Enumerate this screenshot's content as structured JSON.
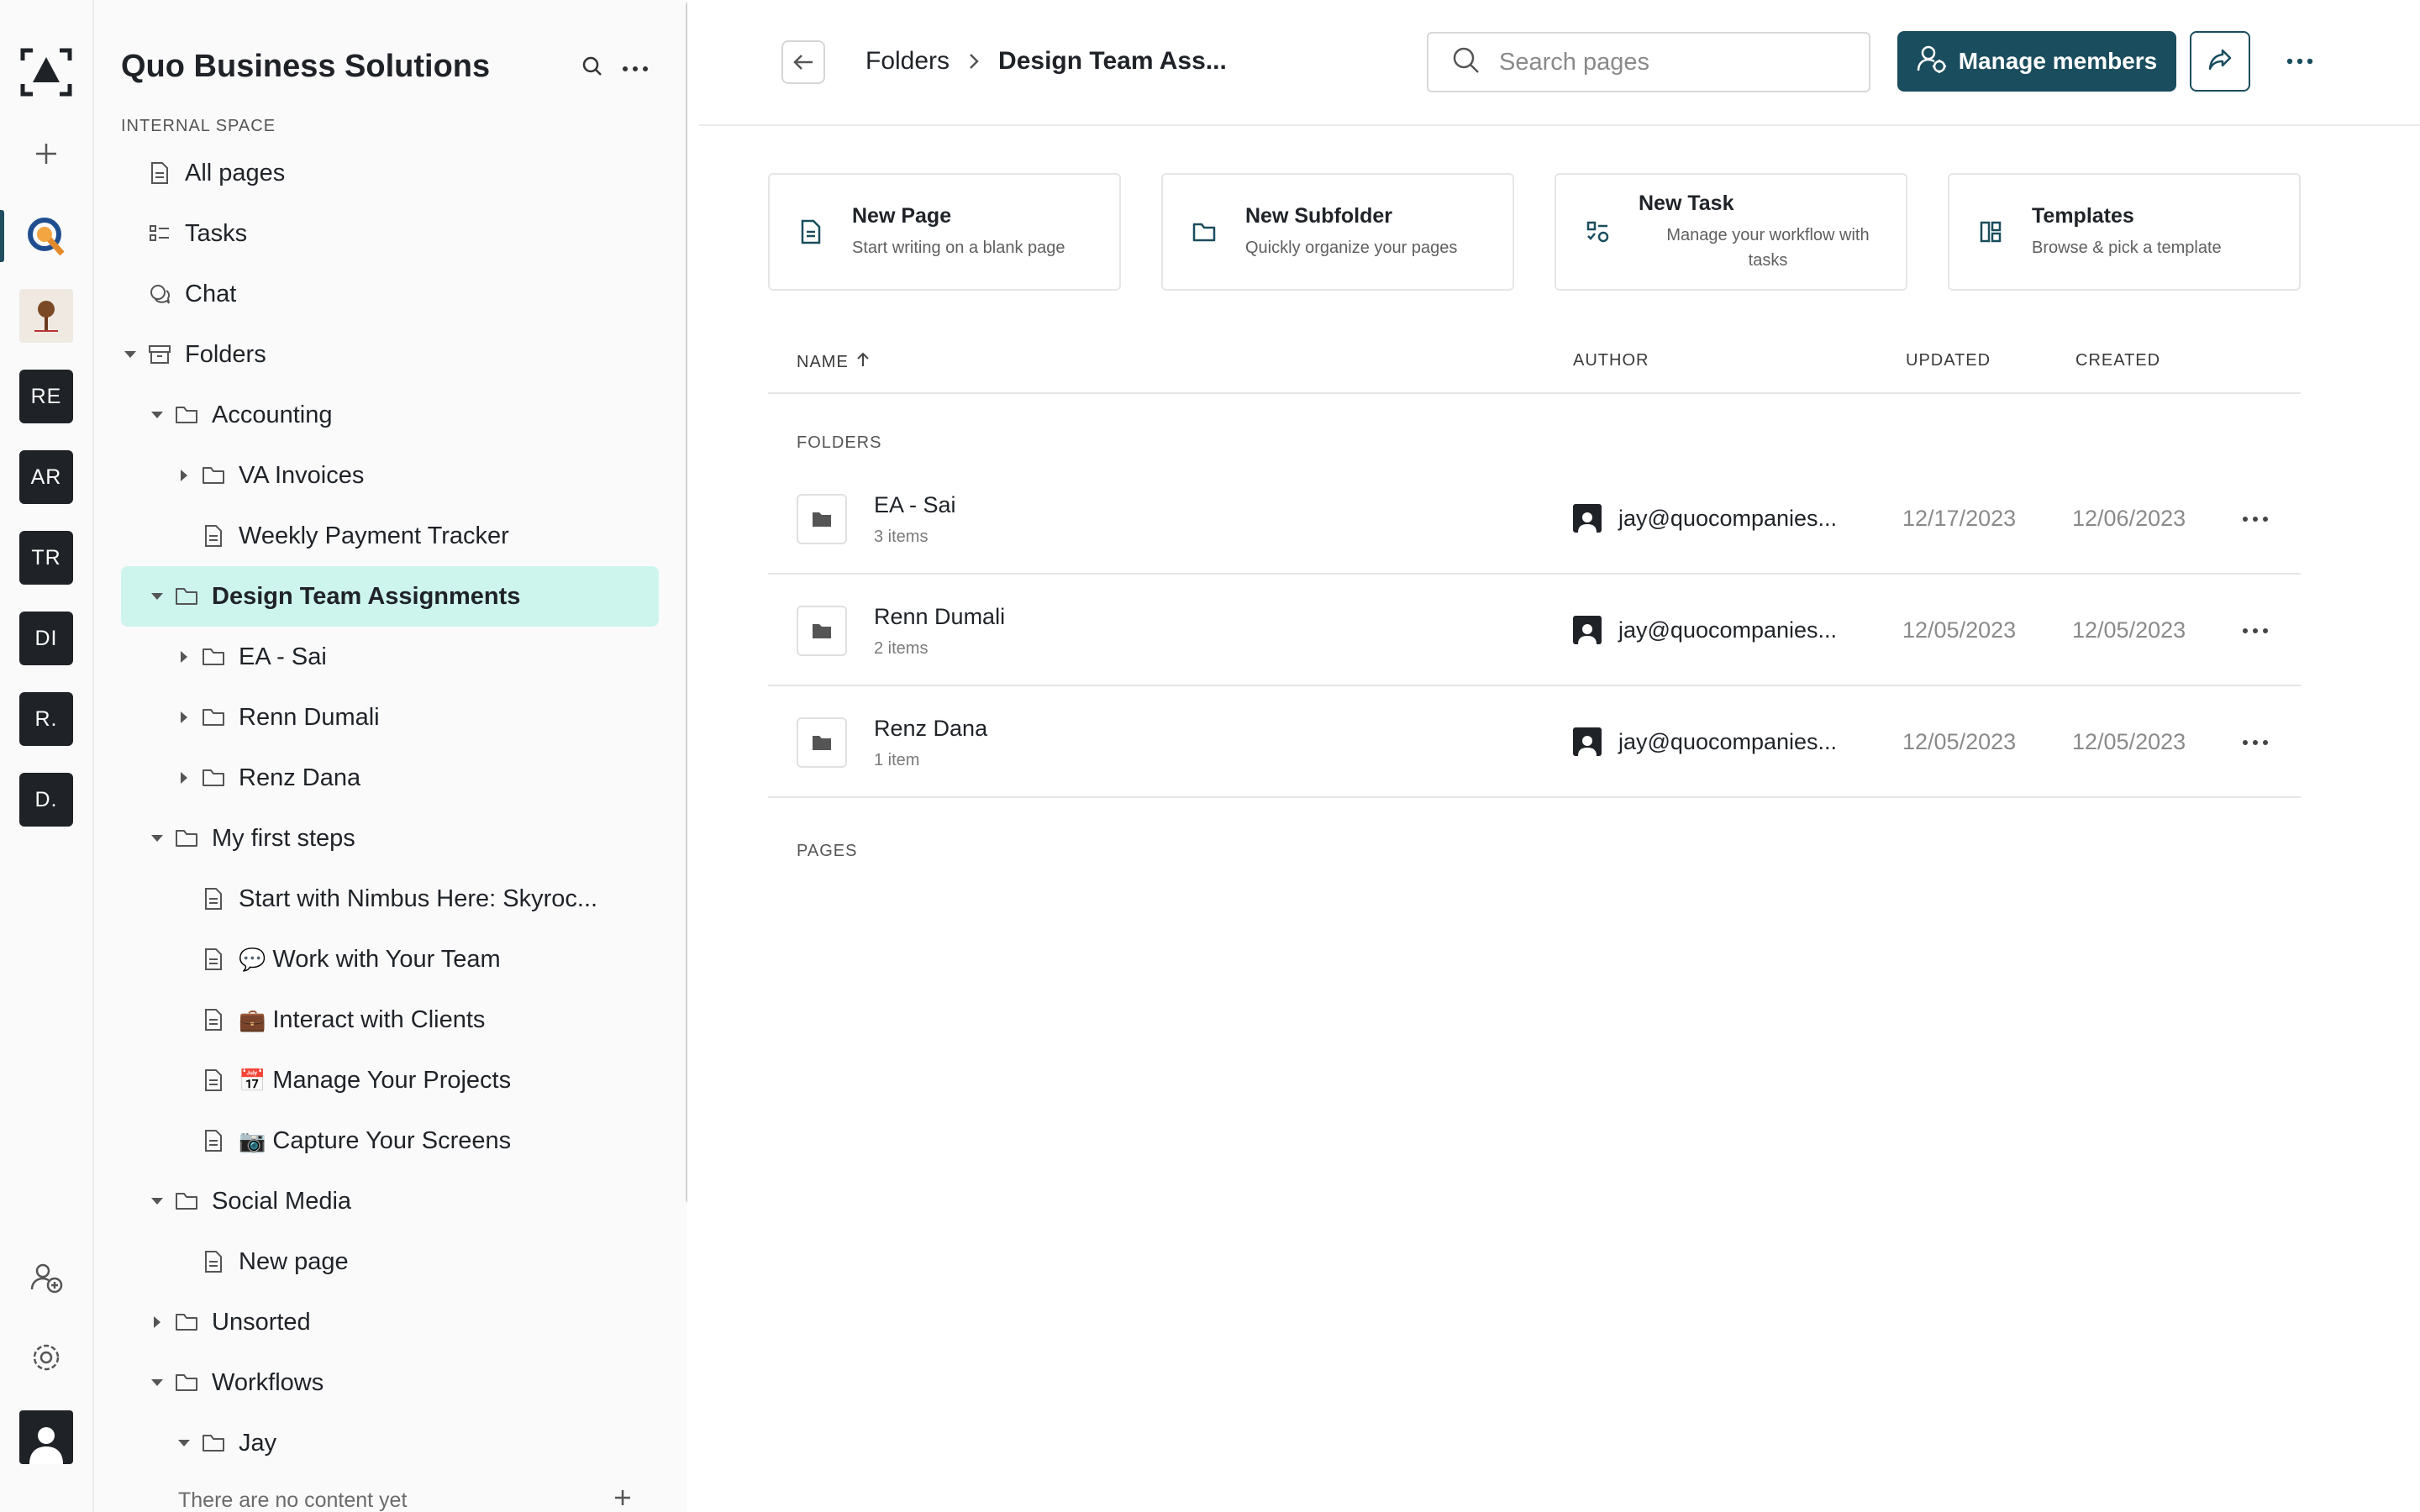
{
  "rail": {
    "workspaces": [
      "RE",
      "AR",
      "TR",
      "DI",
      "R.",
      "D."
    ]
  },
  "sidebar": {
    "space_title": "Quo Business Solutions",
    "space_label": "INTERNAL SPACE",
    "tree": [
      {
        "label": "All pages",
        "icon": "page-icon",
        "level": 0,
        "caret": "none"
      },
      {
        "label": "Tasks",
        "icon": "tasks-icon",
        "level": 0,
        "caret": "none"
      },
      {
        "label": "Chat",
        "icon": "chat-icon",
        "level": 0,
        "caret": "none"
      },
      {
        "label": "Folders",
        "icon": "archive-icon",
        "level": 0,
        "caret": "down"
      },
      {
        "label": "Accounting",
        "icon": "folder-icon",
        "level": 1,
        "caret": "down"
      },
      {
        "label": "VA Invoices",
        "icon": "folder-icon",
        "level": 2,
        "caret": "right"
      },
      {
        "label": "Weekly Payment Tracker",
        "icon": "page-icon",
        "level": 2,
        "caret": "none"
      },
      {
        "label": "Design Team Assignments",
        "icon": "folder-icon",
        "level": 1,
        "caret": "down",
        "selected": true
      },
      {
        "label": "EA - Sai",
        "icon": "folder-icon",
        "level": 2,
        "caret": "right"
      },
      {
        "label": "Renn Dumali",
        "icon": "folder-icon",
        "level": 2,
        "caret": "right"
      },
      {
        "label": "Renz Dana",
        "icon": "folder-icon",
        "level": 2,
        "caret": "right"
      },
      {
        "label": "My first steps",
        "icon": "folder-icon",
        "level": 1,
        "caret": "down"
      },
      {
        "label": "Start with Nimbus Here: Skyroc...",
        "icon": "page-icon",
        "level": 2,
        "caret": "none"
      },
      {
        "label": "Work with Your Team",
        "icon": "page-icon",
        "level": 2,
        "caret": "none",
        "emoji": "💬"
      },
      {
        "label": "Interact with Clients",
        "icon": "page-icon",
        "level": 2,
        "caret": "none",
        "emoji": "💼"
      },
      {
        "label": "Manage Your Projects",
        "icon": "page-icon",
        "level": 2,
        "caret": "none",
        "emoji": "📅"
      },
      {
        "label": "Capture Your Screens",
        "icon": "page-icon",
        "level": 2,
        "caret": "none",
        "emoji": "📷"
      },
      {
        "label": "Social Media",
        "icon": "folder-icon",
        "level": 1,
        "caret": "down"
      },
      {
        "label": "New page",
        "icon": "page-icon",
        "level": 2,
        "caret": "none"
      },
      {
        "label": "Unsorted",
        "icon": "folder-icon",
        "level": 1,
        "caret": "right"
      },
      {
        "label": "Workflows",
        "icon": "folder-icon",
        "level": 1,
        "caret": "down"
      },
      {
        "label": "Jay",
        "icon": "folder-icon",
        "level": 2,
        "caret": "down"
      }
    ],
    "empty_text": "There are no content yet"
  },
  "topbar": {
    "crumb_root": "Folders",
    "crumb_current": "Design Team Ass...",
    "search_placeholder": "Search pages",
    "manage_members_label": "Manage members"
  },
  "cards": [
    {
      "title": "New Page",
      "subtitle": "Start writing on a blank page",
      "icon": "page-icon"
    },
    {
      "title": "New Subfolder",
      "subtitle": "Quickly organize your pages",
      "icon": "folder-icon"
    },
    {
      "title": "New Task",
      "subtitle": "Manage your workflow with tasks",
      "icon": "tasks-icon"
    },
    {
      "title": "Templates",
      "subtitle": "Browse & pick a template",
      "icon": "templates-icon"
    }
  ],
  "table": {
    "headers": {
      "name": "NAME",
      "author": "AUTHOR",
      "updated": "UPDATED",
      "created": "CREATED"
    },
    "folders_label": "FOLDERS",
    "pages_label": "PAGES",
    "folders": [
      {
        "name": "EA - Sai",
        "count": "3 items",
        "author": "jay@quocompanies...",
        "updated": "12/17/2023",
        "created": "12/06/2023"
      },
      {
        "name": "Renn Dumali",
        "count": "2 items",
        "author": "jay@quocompanies...",
        "updated": "12/05/2023",
        "created": "12/05/2023"
      },
      {
        "name": "Renz Dana",
        "count": "1 item",
        "author": "jay@quocompanies...",
        "updated": "12/05/2023",
        "created": "12/05/2023"
      }
    ]
  },
  "colors": {
    "accent": "#1a4d5d",
    "selected_bg": "#cdf5ee"
  }
}
